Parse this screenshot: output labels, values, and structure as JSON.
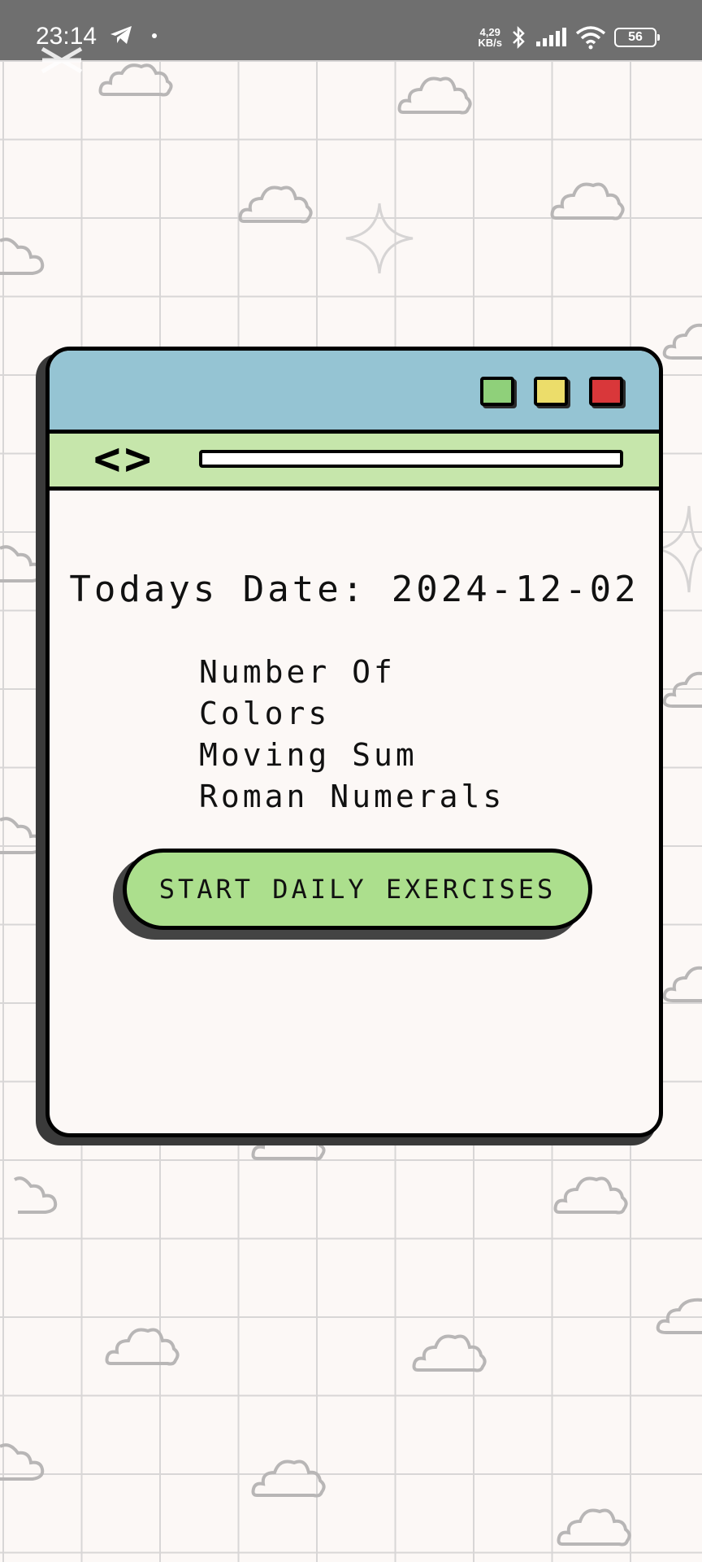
{
  "status_bar": {
    "time": "23:14",
    "net_speed_value": "4,29",
    "net_speed_unit": "KB/s",
    "battery": "56"
  },
  "window": {
    "titlebar_buttons": [
      {
        "name": "green",
        "color": "#8fd07a"
      },
      {
        "name": "yellow",
        "color": "#ecdd6a"
      },
      {
        "name": "red",
        "color": "#d9373a"
      }
    ],
    "code_symbol": "<>"
  },
  "main": {
    "date_text": "Todays Date: 2024-12-02",
    "exercises": [
      "Number Of",
      "Colors",
      "Moving Sum",
      "Roman Numerals"
    ],
    "start_button_label": "START DAILY EXERCISES"
  },
  "colors": {
    "titlebar": "#95c4d3",
    "addressbar": "#c6e6ab",
    "start_button": "#acdf8d",
    "background": "#fcf8f6"
  }
}
